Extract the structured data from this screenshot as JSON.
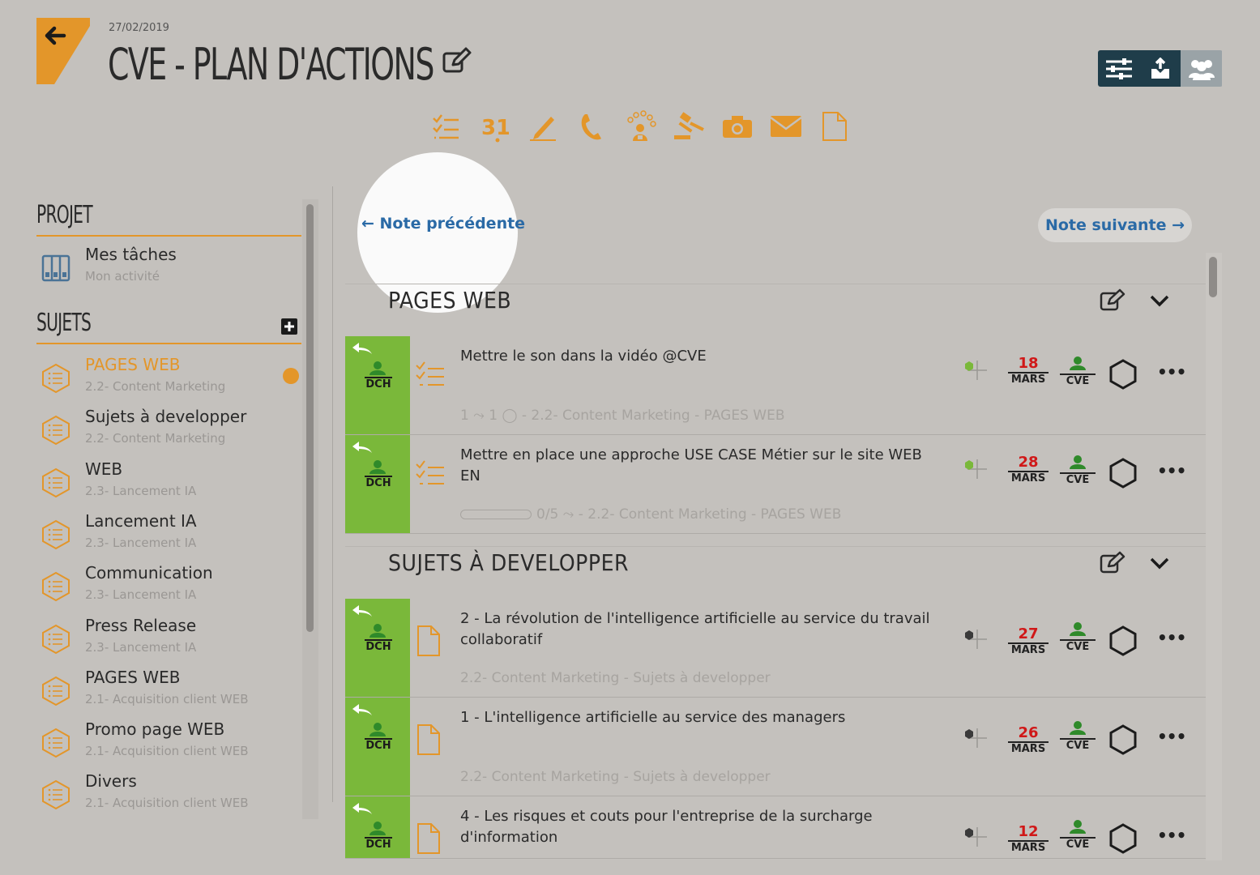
{
  "header": {
    "date": "27/02/2019",
    "title": "CVE - PLAN D'ACTIONS"
  },
  "top_tools": [
    "sliders-icon",
    "export-icon",
    "team-icon"
  ],
  "action_bar": [
    "checklist-icon",
    "calendar-31-icon",
    "pencil-icon",
    "phone-icon",
    "meeting-icon",
    "gavel-icon",
    "camera-icon",
    "mail-icon",
    "document-icon"
  ],
  "action_bar_glyph": "31",
  "sidebar": {
    "projet_heading": "PROJET",
    "my_tasks": {
      "label": "Mes tâches",
      "sub": "Mon activité"
    },
    "sujets_heading": "SUJETS",
    "items": [
      {
        "name": "PAGES WEB",
        "sub": "2.2- Content Marketing",
        "active": true
      },
      {
        "name": "Sujets à developper",
        "sub": "2.2- Content Marketing"
      },
      {
        "name": "WEB",
        "sub": "2.3- Lancement IA"
      },
      {
        "name": "Lancement IA",
        "sub": "2.3- Lancement IA"
      },
      {
        "name": "Communication",
        "sub": "2.3- Lancement IA"
      },
      {
        "name": "Press Release",
        "sub": "2.3- Lancement IA"
      },
      {
        "name": "PAGES WEB",
        "sub": "2.1- Acquisition client WEB"
      },
      {
        "name": "Promo page WEB",
        "sub": "2.1- Acquisition client WEB"
      },
      {
        "name": "Divers",
        "sub": "2.1- Acquisition client WEB"
      }
    ]
  },
  "nav": {
    "prev": "← Note précédente",
    "next": "Note suivante →"
  },
  "sections": [
    {
      "title": "PAGES WEB",
      "tasks": [
        {
          "assignee": "DCH",
          "text": "Mettre le son dans la vidéo @CVE",
          "meta": "1 ⤳ 1 ◯ - 2.2- Content Marketing - PAGES WEB",
          "day": "18",
          "month": "MARS",
          "owner": "CVE",
          "type": "checklist"
        },
        {
          "assignee": "DCH",
          "text": "Mettre en place une approche USE CASE Métier sur le site WEB EN",
          "meta": "0/5 ⤳ - 2.2- Content Marketing - PAGES WEB",
          "day": "28",
          "month": "MARS",
          "owner": "CVE",
          "type": "checklist",
          "progress": 0
        }
      ]
    },
    {
      "title": "SUJETS À DEVELOPPER",
      "tasks": [
        {
          "assignee": "DCH",
          "text": "2 - La révolution de l'intelligence artificielle au service du travail collaboratif",
          "meta": "2.2- Content Marketing - Sujets à developper",
          "day": "27",
          "month": "MARS",
          "owner": "CVE",
          "type": "document"
        },
        {
          "assignee": "DCH",
          "text": "1 - L'intelligence artificielle au service des managers",
          "meta": "2.2- Content Marketing - Sujets à developper",
          "day": "26",
          "month": "MARS",
          "owner": "CVE",
          "type": "document"
        },
        {
          "assignee": "DCH",
          "text": "4 - Les risques et couts pour l'entreprise de la surcharge d'information",
          "meta": "",
          "day": "12",
          "month": "MARS",
          "owner": "CVE",
          "type": "document"
        }
      ]
    }
  ],
  "more_label": "•••",
  "colors": {
    "accent": "#e3962a",
    "green": "#7ab83a",
    "date_red": "#d01818",
    "link": "#2a6aa6",
    "dark_tool": "#1f3d4a"
  }
}
